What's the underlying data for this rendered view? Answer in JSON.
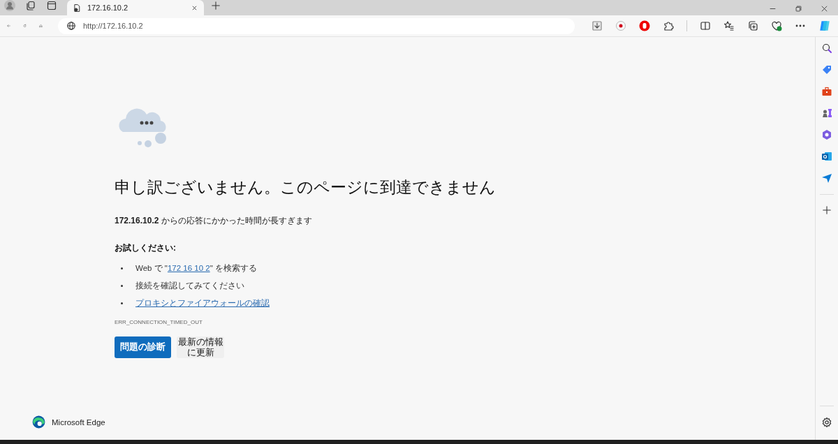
{
  "tab": {
    "title": "172.16.10.2",
    "selected": true
  },
  "address": {
    "value": "http://172.16.10.2"
  },
  "error": {
    "title": "申し訳ございません。このページに到達できません",
    "host": "172.16.10.2",
    "message": "からの応答にかかった時間が長すぎます",
    "try_heading": "お試しください:",
    "suggestions": [
      {
        "kind": "search",
        "prefix": "Web で \"",
        "link": "172 16 10 2",
        "suffix": "\" を検索する"
      },
      {
        "kind": "text",
        "text": "接続を確認してみてください"
      },
      {
        "kind": "link",
        "text": "プロキシとファイアウォールの確認"
      }
    ],
    "code": "ERR_CONNECTION_TIMED_OUT",
    "buttons": [
      {
        "label": "問題の診断",
        "kind": "primary"
      },
      {
        "label": "最新の情報に更新",
        "kind": "secondary"
      }
    ]
  },
  "brand": "Microsoft Edge"
}
